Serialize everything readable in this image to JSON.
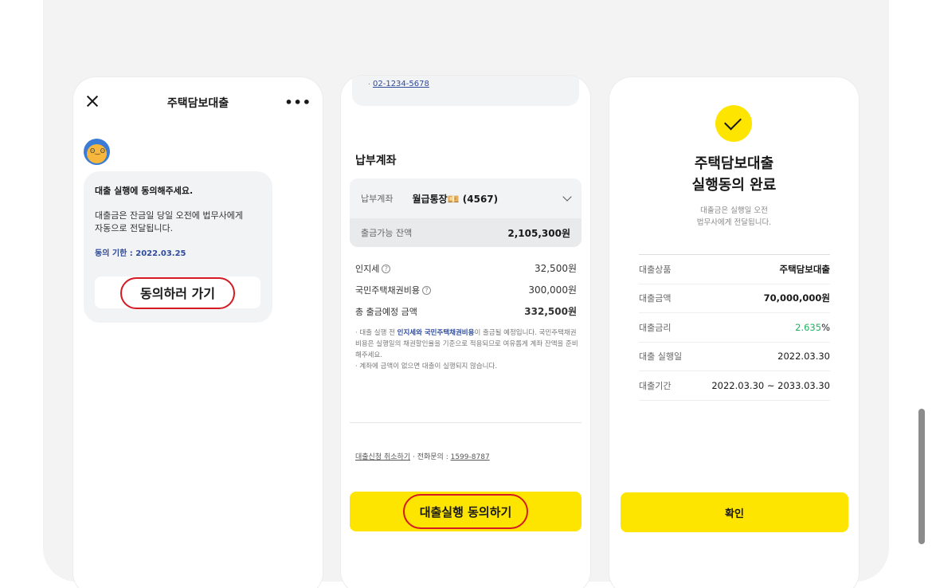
{
  "screen1": {
    "title": "주택담보대출",
    "more": "•••",
    "message_heading": "대출 실행에 동의해주세요.",
    "message_line1": "대출금은 잔금일 당일 오전에 법무사에게",
    "message_line2": "자동으로 전달됩니다.",
    "deadline": "동의 기한 : 2022.03.25",
    "agree_button": "동의하러 가기",
    "avatar_eyes": "ʘ‿ʘ"
  },
  "screen2": {
    "phone_number": "02-1234-5678",
    "section_title": "납부계좌",
    "account_label": "납부계좌",
    "account_name": "월급통장💴 (4567)",
    "balance_label": "출금가능 잔액",
    "balance_value": "2,105,300원",
    "fees": [
      {
        "label": "인지세",
        "value": "32,500원",
        "help": "?"
      },
      {
        "label": "국민주택채권비용",
        "value": "300,000원",
        "help": "?"
      }
    ],
    "total_label": "총 출금예정 금액",
    "total_value": "332,500원",
    "notice_pre": "· 대출 실행 전 ",
    "notice_bold": "인지세와 국민주택채권비용",
    "notice_post": "이 출금될 예정입니다. 국민주택채권비용은 실행일의 채권할인율을 기준으로 적용되므로 여유롭게 계좌 잔액을 준비해주세요.",
    "notice_line2": "· 계좌에 금액이 없으면 대출이 실행되지 않습니다.",
    "cancel_link": "대출신청 취소하기",
    "phone_inquiry_label": "전화문의 :",
    "phone_inquiry_number": "1599-8787",
    "agree_button": "대출실행 동의하기"
  },
  "screen3": {
    "title_line1": "주택담보대출",
    "title_line2": "실행동의 완료",
    "sub_line1": "대출금은 실행일 오전",
    "sub_line2": "법무사에게 전달됩니다.",
    "rows": [
      {
        "label": "대출상품",
        "value": "주택담보대출"
      },
      {
        "label": "대출금액",
        "value": "70,000,000원"
      },
      {
        "label": "대출금리",
        "value_rate": "2.635",
        "value_unit": "%"
      },
      {
        "label": "대출 실행일",
        "value": "2022.03.30"
      },
      {
        "label": "대출기간",
        "value": "2022.03.30 ~ 2033.03.30"
      }
    ],
    "confirm_button": "확인"
  },
  "colors": {
    "accent_yellow": "#fee500",
    "highlight_red": "#d41a22",
    "link_blue": "#2e4b9c",
    "rate_green": "#1db35e"
  }
}
